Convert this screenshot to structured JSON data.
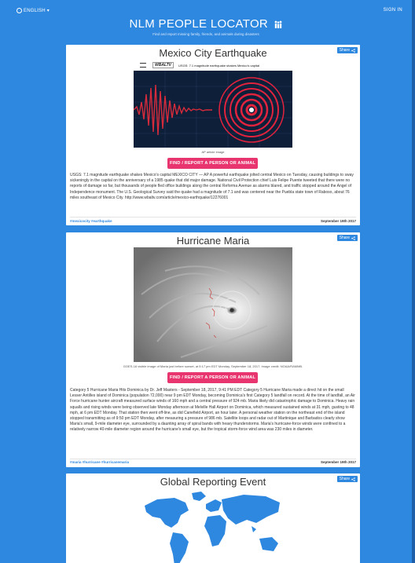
{
  "header": {
    "language": "ENGLISH",
    "language_caret": "▾",
    "signin": "SIGN IN",
    "title": "NLM PEOPLE LOCATOR",
    "people_icon": "🏠",
    "tagline": "Find and report missing family, friends, and animals during disasters"
  },
  "share_label": "Share",
  "share_icon": "share-icon",
  "find_button_label": "FIND / REPORT A PERSON OR ANIMAL",
  "events": [
    {
      "title": "Mexico City Earthquake",
      "video_channel": "WBALTV",
      "video_title": "USGS: 7.1 magnitude earthquake shakes Mexico's capital",
      "caption": "AP article image",
      "text": "USGS: 7.1 magnitude earthquake shakes Mexico's capital MEXICO CITY — AP A powerful earthquake jolted central Mexico on Tuesday, causing buildings to sway sickeningly in the capital on the anniversary of a 1985 quake that did major damage. National Civil Protection chief Luis Felipe Puente tweeted that there were no reports of damage so far, but thousands of people fled office buildings along the central Reforma Avenue as alarms blared, and traffic stopped around the Angel of Independence monument. The U.S. Geological Survey said the quake had a magnitude of 7.1 and was centered near the Puebla state town of Raboso, about 76 miles southeast of Mexico City. http://www.wbaltv.com/article/mexico-earthquake/12276001",
      "tags": "#mexicocity #earthquake",
      "date": "September 19th 2017"
    },
    {
      "title": "Hurricane Maria",
      "caption": "GOES-16 visible image of Maria just before sunset, at 5:17 pm EDT Monday, September 18, 2017. Image credit: NOAA/RAMMB.",
      "text": "Category 5 Hurricane Maria Hits Dominica by Dr. Jeff Masters - September 18, 2017, 9:41 PM EDT Category 5 Hurricane Maria made a direct hit on the small Lesser Antilles island of Dominica (population 72,000) near 9 pm EDT Monday, becoming Dominica's first Category 5 landfall on record. At the time of landfall, an Air Force hurricane hunter aircraft measured surface winds of 160 mph and a central pressure of 924 mb. Maria likely did catastrophic damage to Dominica. Heavy rain squalls and rising winds were being observed late Monday afternoon at Melville Hall Airport on Dominica, which measured sustained winds at 31 mph, gusting to 48 mph, at 6 pm EDT Monday. That station then went off-line, as did Canefield Airport, an hour later. A personal weather station on the northeast end of the island stopped transmitting as of 9:50 pm EDT Monday, after measuring a pressure of 986 mb. Satellite loops and radar out of Martinique and Barbados clearly show Maria's small, 9-mile diameter eye, surrounded by a daunting array of spiral bands with heavy thunderstorms. Maria's hurricane-force winds were confined to a relatively narrow 40-mile diameter region around the hurricane's small eye, but the tropical storm-force wind area was 230 miles in diameter.",
      "tags": "#maria #hurricane #hurricanemaria",
      "date": "September 19th 2017"
    },
    {
      "title": "Global Reporting Event"
    }
  ],
  "colors": {
    "page_blue": "#2f88e0",
    "button_pink": "#e8356f"
  }
}
